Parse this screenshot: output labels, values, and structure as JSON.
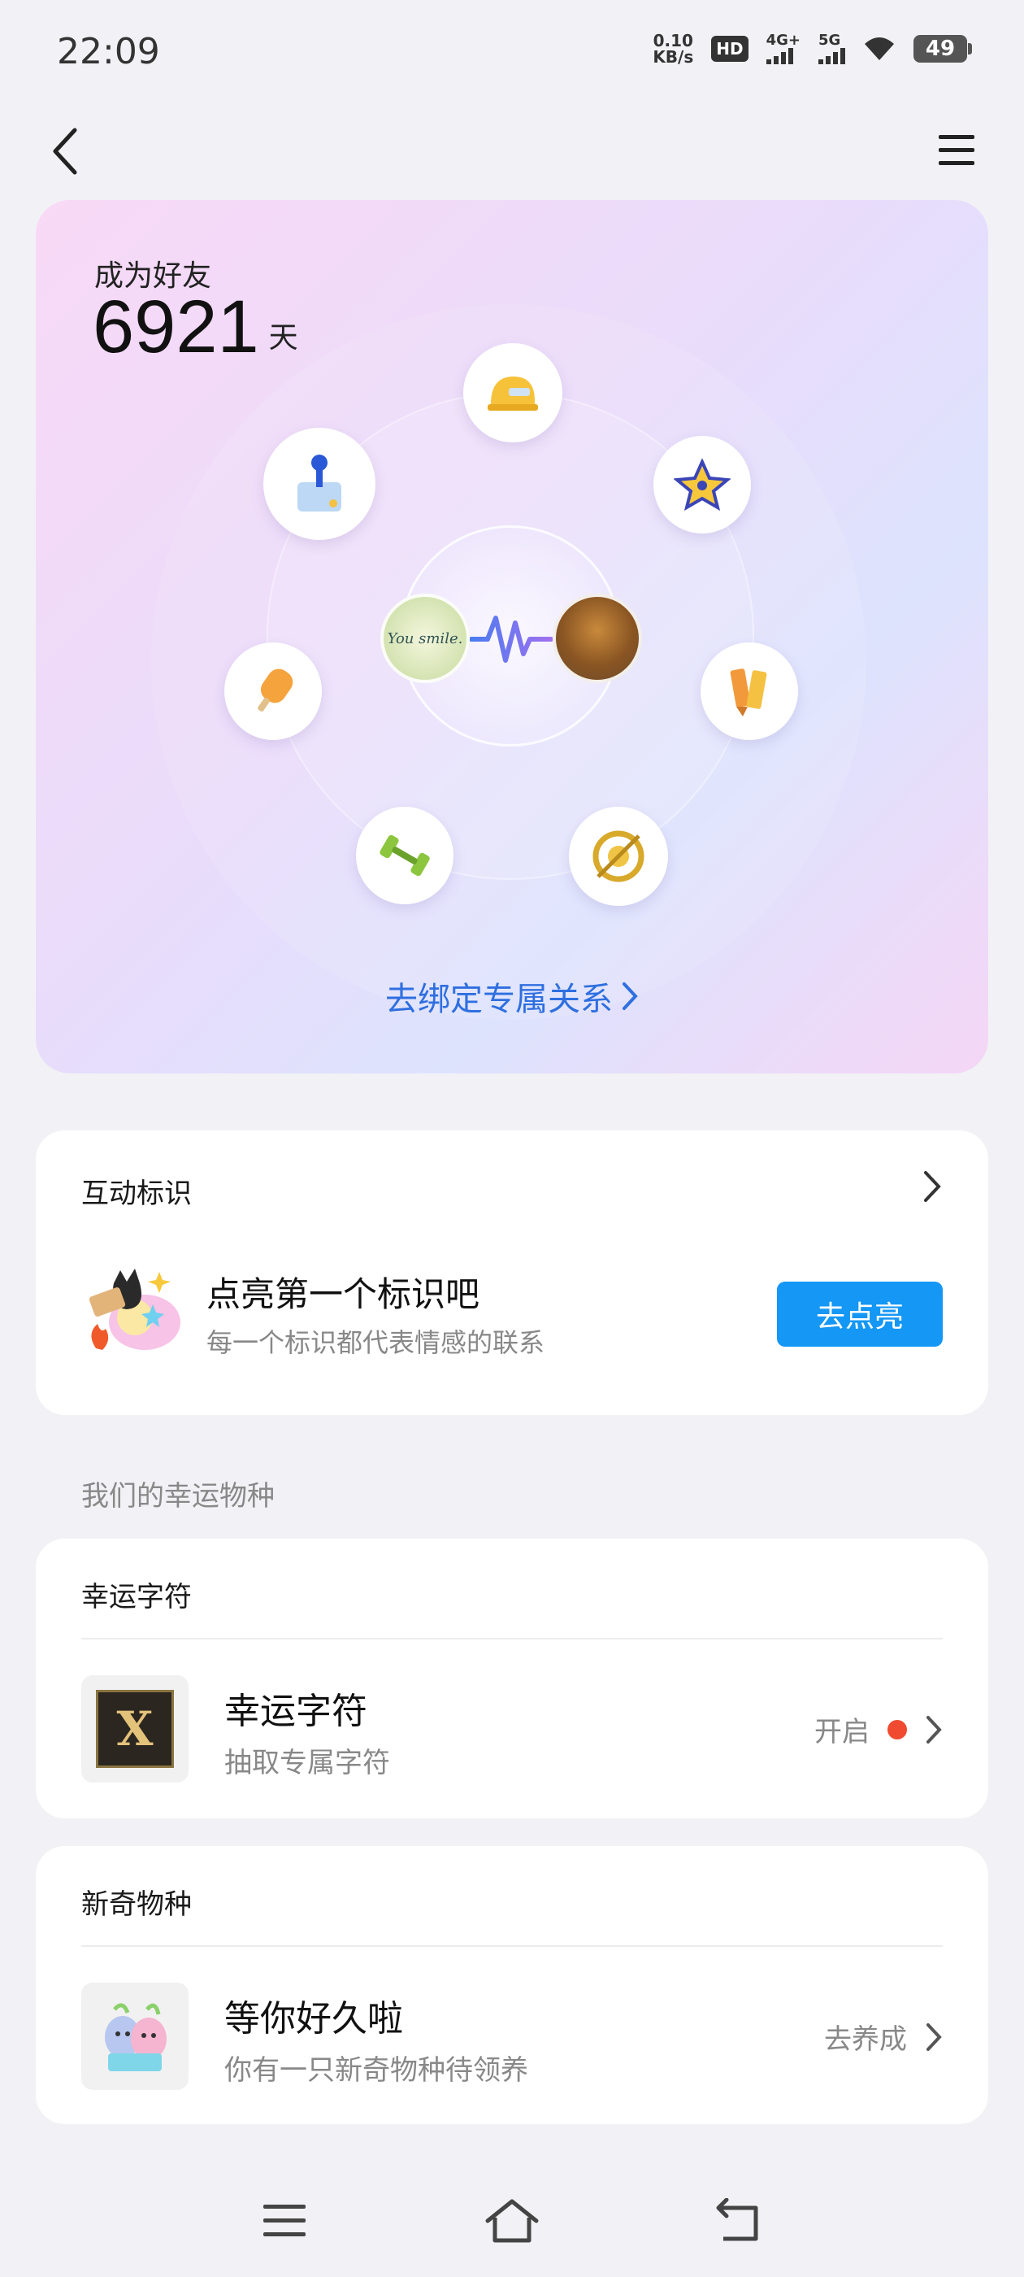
{
  "status_bar": {
    "time": "22:09",
    "net_speed_value": "0.10",
    "net_speed_unit": "KB/s",
    "hd_badge": "HD",
    "sim1_label": "4G+",
    "sim2_label": "5G",
    "battery_level": "49",
    "icons": [
      "hd-icon",
      "signal-icon",
      "wifi-icon",
      "battery-icon"
    ]
  },
  "header": {
    "back_icon": "chevron-left-icon",
    "menu_icon": "menu-icon"
  },
  "hero": {
    "friend_label": "成为好友",
    "friend_days": "6921",
    "friend_days_unit": "天",
    "avatar_left_text": "You smile.",
    "bind_link": "去绑定专属关系",
    "badges": [
      "helmet-badge",
      "star-badge",
      "pencil-badge",
      "target-badge",
      "dumbbell-badge",
      "popsicle-badge",
      "joystick-badge"
    ]
  },
  "interaction_card": {
    "title": "互动标识",
    "main_text": "点亮第一个标识吧",
    "sub_text": "每一个标识都代表情感的联系",
    "button_label": "去点亮"
  },
  "section_label": "我们的幸运物种",
  "lucky_card": {
    "header": "幸运字符",
    "item_title": "幸运字符",
    "item_sub": "抽取专属字符",
    "action_label": "开启",
    "thumb_letter": "X"
  },
  "novel_card": {
    "header": "新奇物种",
    "item_title": "等你好久啦",
    "item_sub": "你有一只新奇物种待领养",
    "action_label": "去养成"
  },
  "nav_bar": {
    "icons": [
      "menu-nav-icon",
      "home-nav-icon",
      "back-nav-icon"
    ]
  },
  "colors": {
    "accent_blue": "#1497f5",
    "link_blue": "#2f6fe0",
    "red_dot": "#f04a30",
    "page_bg": "#f2f2f6"
  }
}
